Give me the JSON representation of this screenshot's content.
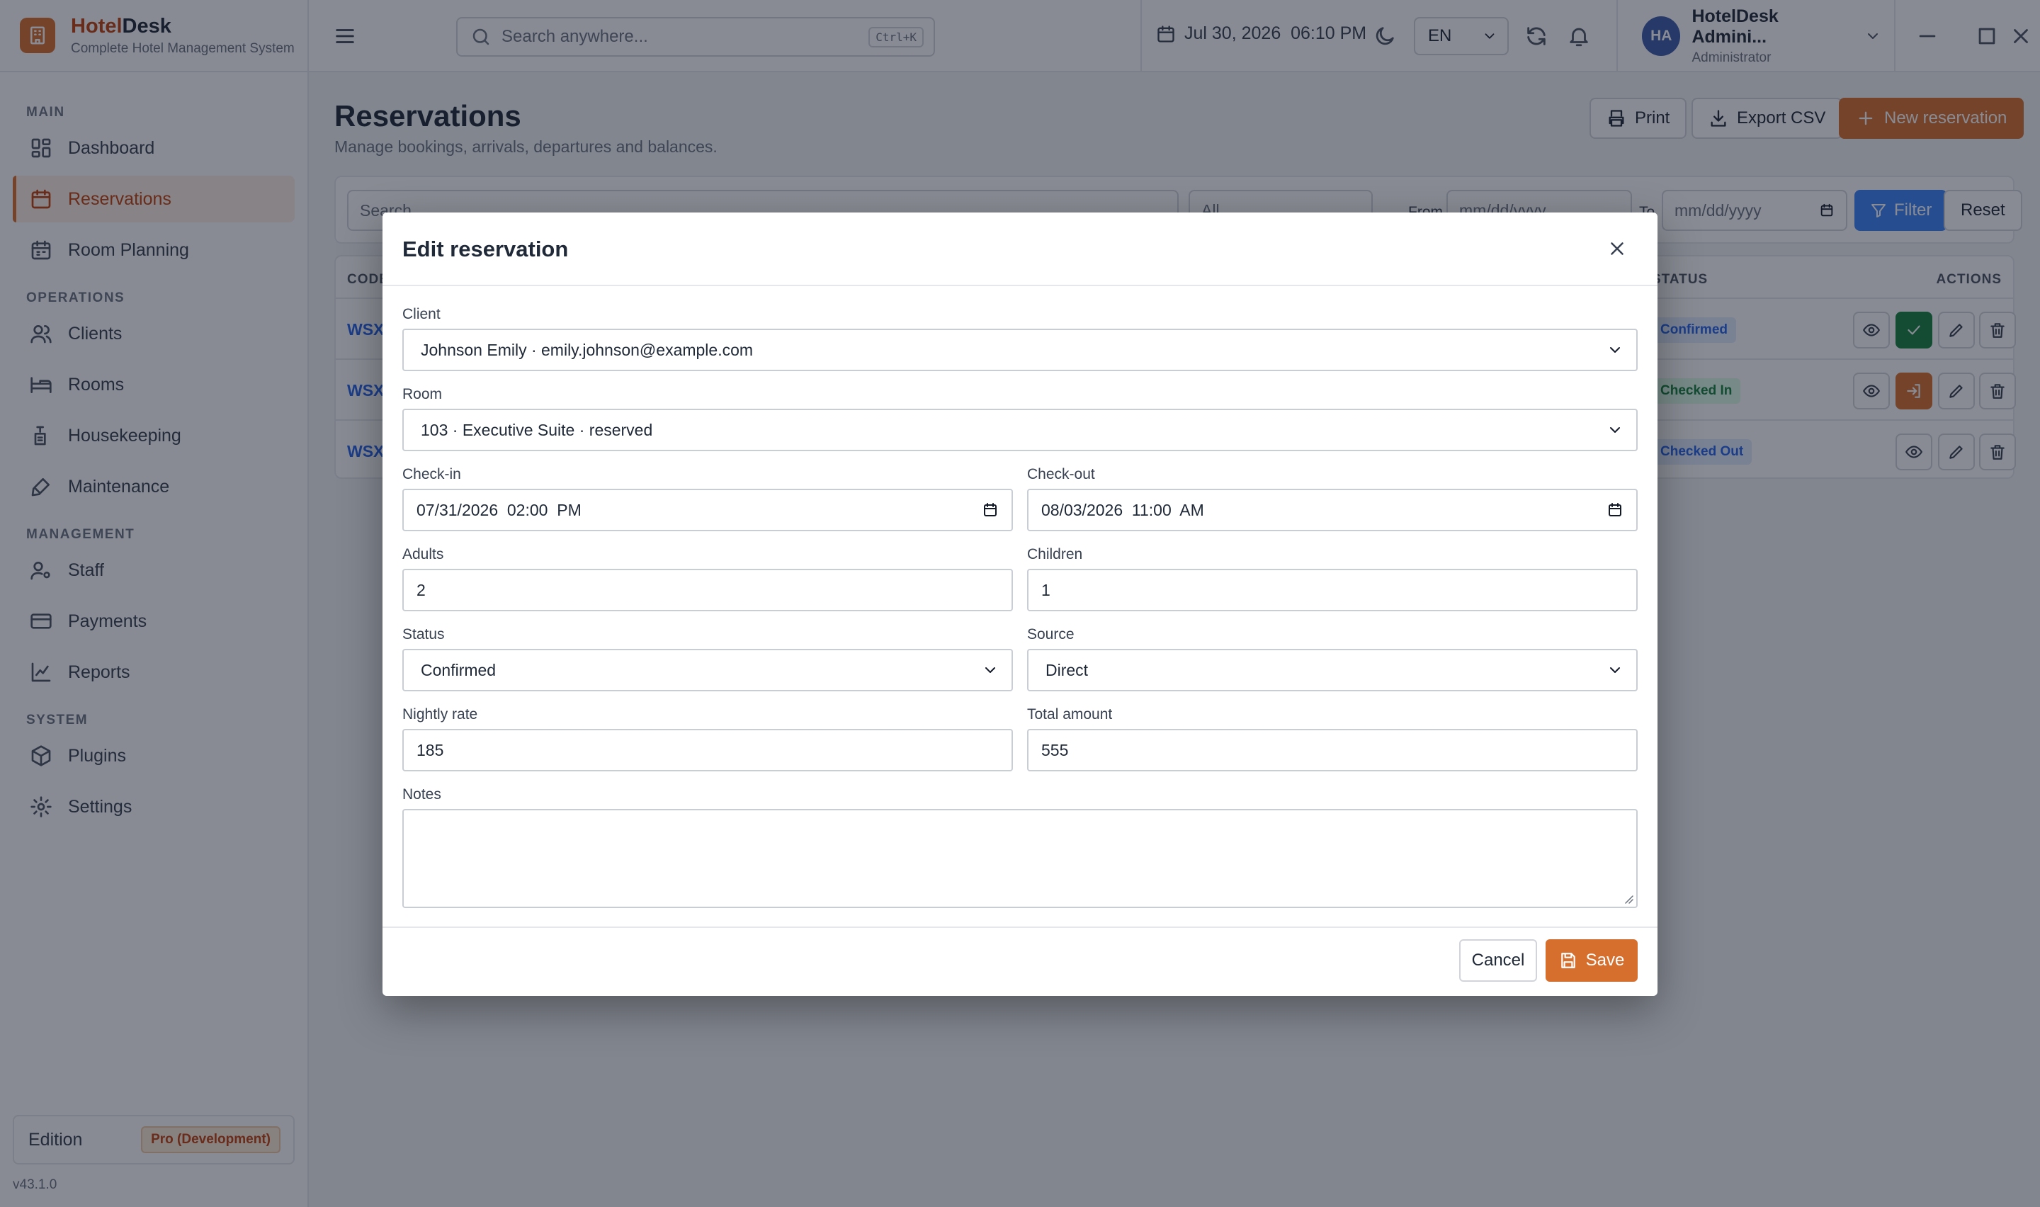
{
  "brand": {
    "name_a": "Hotel",
    "name_b": "Desk",
    "subtitle": "Complete Hotel Management System"
  },
  "sidebar": {
    "sections": [
      {
        "title": "MAIN",
        "items": [
          {
            "label": "Dashboard",
            "icon": "dashboard-icon"
          },
          {
            "label": "Reservations",
            "icon": "calendar-icon",
            "active": true
          },
          {
            "label": "Room Planning",
            "icon": "calendar-grid-icon"
          }
        ]
      },
      {
        "title": "OPERATIONS",
        "items": [
          {
            "label": "Clients",
            "icon": "users-icon"
          },
          {
            "label": "Rooms",
            "icon": "bed-icon"
          },
          {
            "label": "Housekeeping",
            "icon": "cleaning-icon"
          },
          {
            "label": "Maintenance",
            "icon": "wrench-icon"
          }
        ]
      },
      {
        "title": "MANAGEMENT",
        "items": [
          {
            "label": "Staff",
            "icon": "user-cog-icon"
          },
          {
            "label": "Payments",
            "icon": "credit-card-icon"
          },
          {
            "label": "Reports",
            "icon": "chart-line-icon"
          }
        ]
      },
      {
        "title": "SYSTEM",
        "items": [
          {
            "label": "Plugins",
            "icon": "box-icon"
          },
          {
            "label": "Settings",
            "icon": "gear-icon"
          }
        ]
      }
    ],
    "edition_label": "Edition",
    "edition_value": "Pro (Development)",
    "version": "v43.1.0"
  },
  "topbar": {
    "search_placeholder": "Search anywhere...",
    "search_shortcut": "Ctrl+K",
    "datetime": "Jul 30, 2026  06:10 PM",
    "language": "EN",
    "user_initials": "HA",
    "user_name": "HotelDesk Admini...",
    "user_role": "Administrator"
  },
  "page": {
    "title": "Reservations",
    "subtitle": "Manage bookings, arrivals, departures and balances.",
    "print_label": "Print",
    "export_label": "Export CSV",
    "new_label": "New reservation"
  },
  "filters": {
    "search_placeholder": "Search",
    "status_value": "All",
    "from_label": "From",
    "from_placeholder": "mm/dd/yyyy",
    "to_label": "To",
    "to_placeholder": "mm/dd/yyyy",
    "filter_label": "Filter",
    "reset_label": "Reset"
  },
  "table": {
    "headers": {
      "code": "CODE",
      "status": "STATUS",
      "actions": "ACTIONS"
    },
    "rows": [
      {
        "code": "WSX",
        "status": "Confirmed"
      },
      {
        "code": "WSX",
        "status": "Checked In"
      },
      {
        "code": "WSX",
        "status": "Checked Out"
      }
    ]
  },
  "modal": {
    "title": "Edit reservation",
    "client_label": "Client",
    "client_value": "Johnson Emily · emily.johnson@example.com",
    "room_label": "Room",
    "room_value": "103 · Executive Suite · reserved",
    "checkin_label": "Check-in",
    "checkin_value": "07/31/2026  02:00  PM",
    "checkout_label": "Check-out",
    "checkout_value": "08/03/2026  11:00  AM",
    "adults_label": "Adults",
    "adults_value": "2",
    "children_label": "Children",
    "children_value": "1",
    "status_label": "Status",
    "status_value": "Confirmed",
    "source_label": "Source",
    "source_value": "Direct",
    "rate_label": "Nightly rate",
    "rate_value": "185",
    "total_label": "Total amount",
    "total_value": "555",
    "notes_label": "Notes",
    "notes_value": "",
    "cancel_label": "Cancel",
    "save_label": "Save"
  },
  "colors": {
    "accent": "#d66f2d",
    "link": "#2563eb",
    "success": "#15803d",
    "filter": "#3b82f6"
  }
}
